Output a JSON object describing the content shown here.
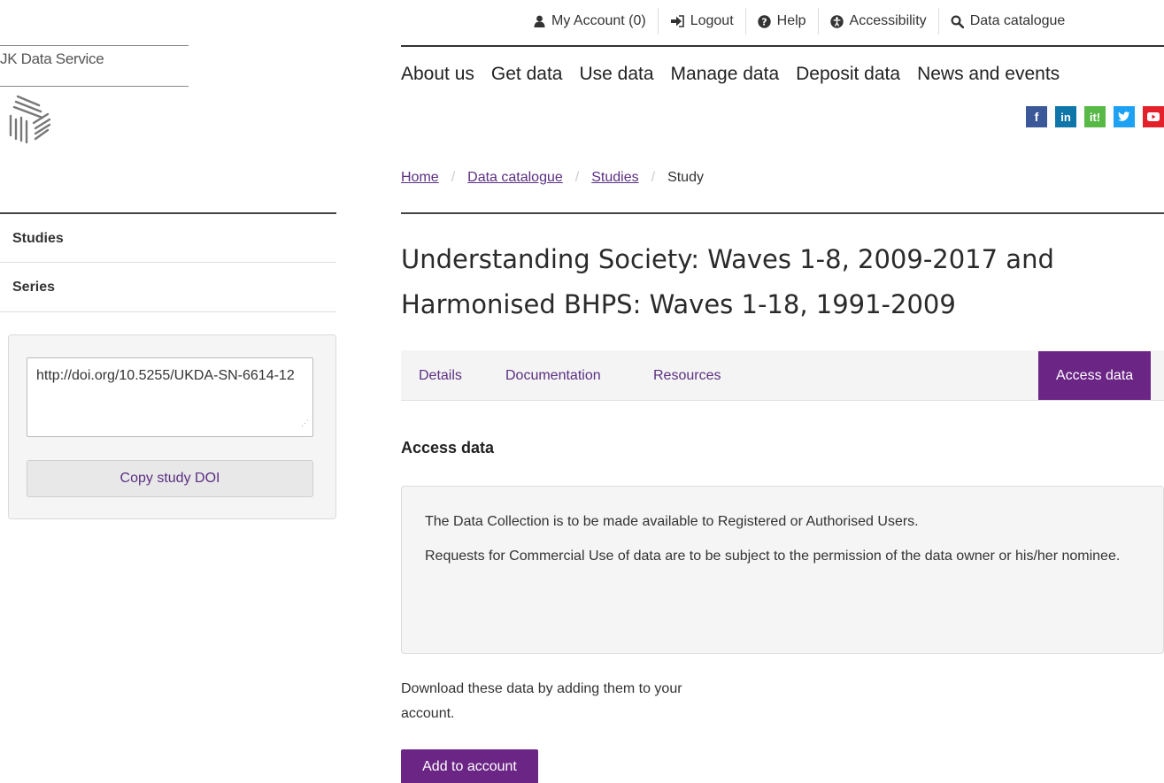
{
  "brand": {
    "name": "JK Data Service"
  },
  "sidebar": {
    "items": [
      {
        "label": "Studies"
      },
      {
        "label": "Series"
      }
    ],
    "doi": {
      "value": "http://doi.org/10.5255/UKDA-SN-6614-12",
      "copy_label": "Copy study DOI"
    }
  },
  "utility_nav": {
    "items": [
      {
        "label": "My Account (0)",
        "icon": "user-icon"
      },
      {
        "label": "Logout",
        "icon": "logout-icon"
      },
      {
        "label": "Help",
        "icon": "help-icon"
      },
      {
        "label": "Accessibility",
        "icon": "accessibility-icon"
      },
      {
        "label": "Data catalogue",
        "icon": "search-icon"
      }
    ]
  },
  "main_nav": {
    "items": [
      "About us",
      "Get data",
      "Use data",
      "Manage data",
      "Deposit data",
      "News and events"
    ]
  },
  "social": [
    {
      "name": "facebook-icon",
      "glyph": "f",
      "color": "#3b5998"
    },
    {
      "name": "linkedin-icon",
      "glyph": "in",
      "color": "#0e76a8"
    },
    {
      "name": "iti-icon",
      "glyph": "it!",
      "color": "#58b947"
    },
    {
      "name": "twitter-icon",
      "glyph": "✓",
      "color": "#1da1f2"
    },
    {
      "name": "youtube-icon",
      "glyph": "▶",
      "color": "#e4202a"
    }
  ],
  "breadcrumb": {
    "items": [
      {
        "label": "Home",
        "link": true
      },
      {
        "label": "Data catalogue",
        "link": true
      },
      {
        "label": "Studies",
        "link": true
      },
      {
        "label": "Study",
        "link": false
      }
    ]
  },
  "study": {
    "title": "Understanding Society: Waves 1-8, 2009-2017 and Harmonised BHPS: Waves 1-18, 1991-2009"
  },
  "tabs": [
    {
      "label": "Details"
    },
    {
      "label": "Documentation"
    },
    {
      "label": "Resources"
    },
    {
      "label": "Access data",
      "active": true
    }
  ],
  "access": {
    "heading": "Access data",
    "notice_p1": "The Data Collection is to be made available to Registered or Authorised Users.",
    "notice_p2": "Requests for Commercial Use of data are to be subject to the permission of the data owner or his/her nominee.",
    "download_text": "Download these data by adding them to your account.",
    "add_button": "Add to account"
  },
  "colors": {
    "accent": "#6b2585",
    "link": "#5b2f82"
  }
}
